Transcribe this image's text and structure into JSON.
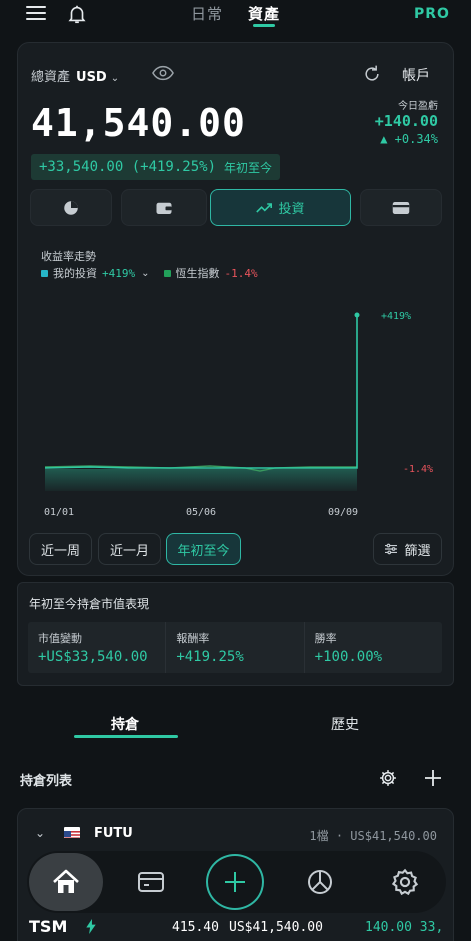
{
  "header": {
    "tabs": [
      "日常",
      "資產"
    ],
    "active_tab": "資產",
    "pro_badge": "PRO",
    "icons": [
      "menu-icon",
      "bell-icon"
    ]
  },
  "summary": {
    "total_label": "總資產",
    "currency": "USD",
    "account_button": "帳戶",
    "total_value": "41,540.00",
    "today_label": "今日盈虧",
    "today_value": "+140.00",
    "today_pct": "▲ +0.34%",
    "ytd_value": "+33,540.00 (+419.25%)",
    "ytd_tag": "年初至今"
  },
  "view_tabs": {
    "items": [
      "pie-chart-icon",
      "wallet-icon",
      "投資",
      "card-icon"
    ],
    "active": "投資"
  },
  "trend": {
    "title": "收益率走勢",
    "legend": [
      {
        "label": "我的投資",
        "value": "+419%",
        "color": "#27b6c8"
      },
      {
        "label": "恆生指數",
        "value": "-1.4%",
        "color": "#22a05a"
      }
    ]
  },
  "chart_data": {
    "type": "line",
    "x": [
      "01/01",
      "05/06",
      "09/09"
    ],
    "x_ticks": [
      "01/01",
      "05/06",
      "09/09"
    ],
    "series": [
      {
        "name": "我的投資",
        "start": "0%",
        "end": "+419%",
        "color": "#2fc9a4"
      },
      {
        "name": "恆生指數",
        "end": "-1.4%",
        "color": "#3a9a5f"
      }
    ],
    "end_labels": [
      "+419%",
      "-1.4%"
    ]
  },
  "ranges": {
    "items": [
      "近一周",
      "近一月",
      "年初至今"
    ],
    "active": "年初至今",
    "filter_label": "篩選"
  },
  "performance": {
    "title": "年初至今持倉市值表現",
    "cells": [
      {
        "label": "市值變動",
        "value": "+US$33,540.00"
      },
      {
        "label": "報酬率",
        "value": "+419.25%"
      },
      {
        "label": "勝率",
        "value": "+100.00%"
      }
    ]
  },
  "holdings": {
    "tabs": [
      "持倉",
      "歷史"
    ],
    "active_tab": "持倉",
    "list_title": "持倉列表",
    "account": {
      "name": "FUTU",
      "summary": "1檔 · US$41,540.00"
    },
    "rows": [
      {
        "symbol": "TSM",
        "price": "415.40",
        "market_value": "US$41,540.00",
        "pl": "140.00 33,"
      }
    ]
  },
  "bottom_nav": [
    "home-icon",
    "wallet-icon",
    "plus-icon",
    "pie-chart-icon",
    "settings-icon"
  ]
}
